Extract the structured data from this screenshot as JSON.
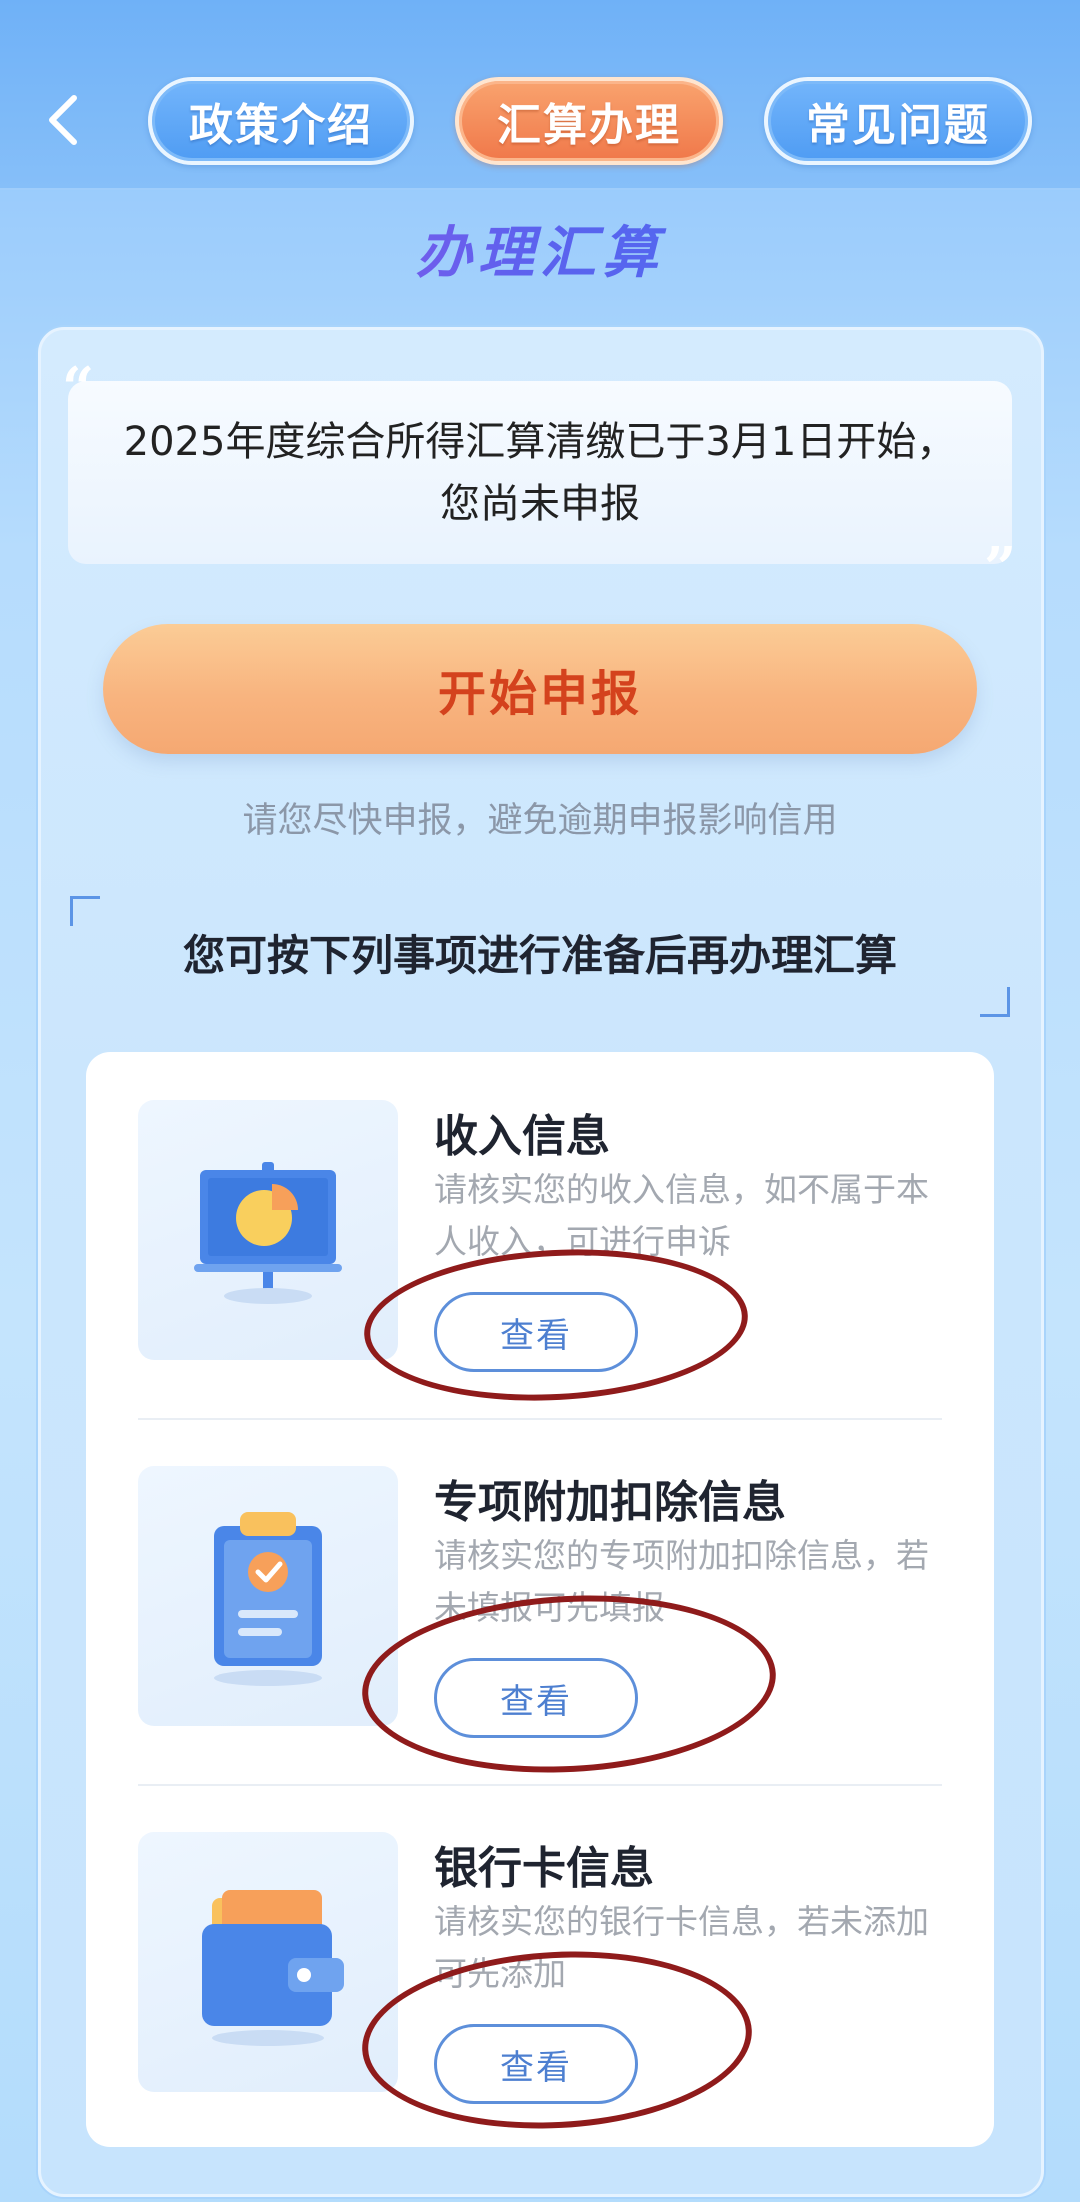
{
  "nav": {
    "back_icon": "chevron-left-icon",
    "tabs": [
      {
        "label": "政策介绍",
        "active": false
      },
      {
        "label": "汇算办理",
        "active": true
      },
      {
        "label": "常见问题",
        "active": false
      }
    ]
  },
  "section_title": "办理汇算",
  "notice": {
    "line1": "2025年度综合所得汇算清缴已于3月1日开始，",
    "line2": "您尚未申报"
  },
  "start_button": "开始申报",
  "hint": "请您尽快申报，避免逾期申报影响信用",
  "prep_title": "您可按下列事项进行准备后再办理汇算",
  "items": [
    {
      "name": "收入信息",
      "desc": "请核实您的收入信息，如不属于本人收入，可进行申诉",
      "button": "查看",
      "icon": "presentation-chart-icon"
    },
    {
      "name": "专项附加扣除信息",
      "desc": "请核实您的专项附加扣除信息，若未填报可先填报",
      "button": "查看",
      "icon": "clipboard-check-icon"
    },
    {
      "name": "银行卡信息",
      "desc": "请核实您的银行卡信息，若未添加可先添加",
      "button": "查看",
      "icon": "wallet-icon"
    }
  ],
  "colors": {
    "accent_orange": "#f0784a",
    "accent_blue": "#4d7fd0",
    "annotation_red": "#8f1b1b"
  }
}
